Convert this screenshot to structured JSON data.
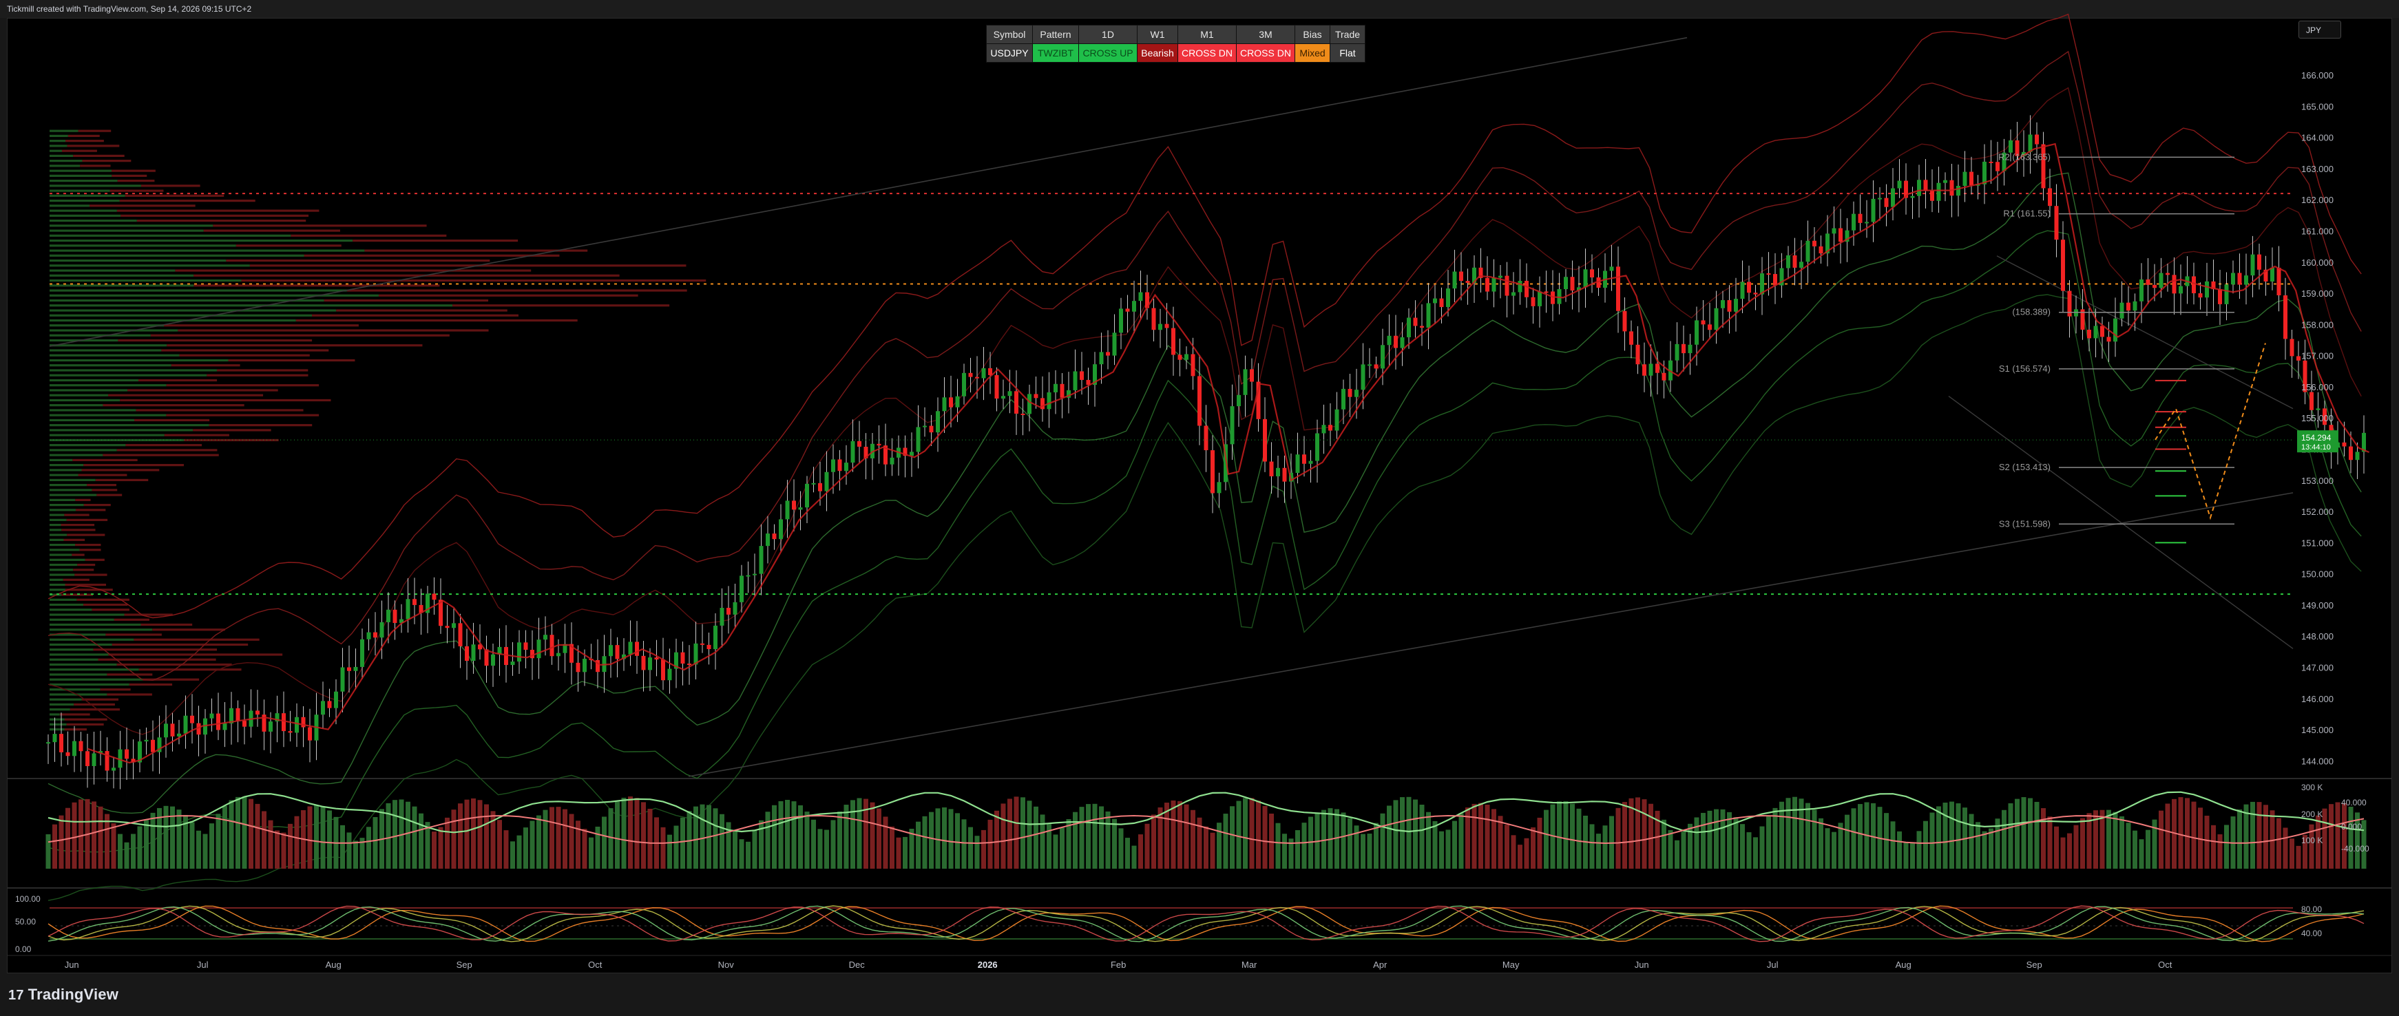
{
  "header": {
    "attribution": "Tickmill created with TradingView.com, Sep 14, 2026 09:15 UTC+2"
  },
  "currency_badge": "JPY",
  "signal_table": {
    "headers": [
      "Symbol",
      "Pattern",
      "1D",
      "W1",
      "M1",
      "3M",
      "Bias",
      "Trade"
    ],
    "values": [
      "USDJPY",
      "TWZIBT",
      "CROSS UP",
      "Bearish",
      "CROSS DN",
      "CROSS DN",
      "Mixed",
      "Flat"
    ],
    "colors": [
      "#3a3a3a",
      "#1fbf4a",
      "#1fbf4a",
      "#a31515",
      "#f0323c",
      "#f0323c",
      "#f08c1a",
      "#3a3a3a"
    ],
    "text_colors": [
      "#ffffff",
      "#0a4d1a",
      "#0a4d1a",
      "#ffffff",
      "#ffffff",
      "#ffffff",
      "#3a2000",
      "#ffffff"
    ]
  },
  "footer": {
    "brand": "TradingView"
  },
  "chart_data": [
    {
      "type": "candlestick",
      "symbol": "USDJPY",
      "ylim": [
        143.5,
        166.2
      ],
      "y_ticks": [
        "166.000",
        "165.000",
        "164.000",
        "163.000",
        "162.000",
        "161.000",
        "160.000",
        "159.000",
        "158.000",
        "157.000",
        "156.000",
        "155.000",
        "154.000",
        "153.000",
        "152.000",
        "151.000",
        "150.000",
        "149.000",
        "148.000",
        "147.000",
        "146.000",
        "145.000",
        "144.000"
      ],
      "x_ticks": [
        "Jun",
        "Jul",
        "Aug",
        "Sep",
        "Oct",
        "Nov",
        "Dec",
        "2026",
        "Feb",
        "Mar",
        "Apr",
        "May",
        "Jun",
        "Jul",
        "Aug",
        "Sep",
        "Oct"
      ],
      "close_path": [
        {
          "m": 0,
          "v": 144.6
        },
        {
          "m": 0.5,
          "v": 143.9
        },
        {
          "m": 1,
          "v": 145.1
        },
        {
          "m": 1.5,
          "v": 145.4
        },
        {
          "m": 2,
          "v": 145.0
        },
        {
          "m": 2.5,
          "v": 148.3
        },
        {
          "m": 2.9,
          "v": 149.2
        },
        {
          "m": 3.2,
          "v": 147.5
        },
        {
          "m": 3.5,
          "v": 147.3
        },
        {
          "m": 3.8,
          "v": 147.8
        },
        {
          "m": 4.1,
          "v": 147.0
        },
        {
          "m": 4.4,
          "v": 147.6
        },
        {
          "m": 4.7,
          "v": 146.9
        },
        {
          "m": 5.0,
          "v": 147.6
        },
        {
          "m": 5.3,
          "v": 149.6
        },
        {
          "m": 5.6,
          "v": 151.8
        },
        {
          "m": 5.9,
          "v": 153.0
        },
        {
          "m": 6.2,
          "v": 154.1
        },
        {
          "m": 6.5,
          "v": 153.7
        },
        {
          "m": 6.9,
          "v": 155.6
        },
        {
          "m": 7.1,
          "v": 156.6
        },
        {
          "m": 7.4,
          "v": 155.3
        },
        {
          "m": 7.7,
          "v": 155.8
        },
        {
          "m": 8.0,
          "v": 156.5
        },
        {
          "m": 8.3,
          "v": 159.0
        },
        {
          "m": 8.5,
          "v": 157.9
        },
        {
          "m": 8.75,
          "v": 156.4
        },
        {
          "m": 8.9,
          "v": 152.4
        },
        {
          "m": 9.15,
          "v": 156.8
        },
        {
          "m": 9.35,
          "v": 153.0
        },
        {
          "m": 9.6,
          "v": 153.6
        },
        {
          "m": 9.9,
          "v": 155.6
        },
        {
          "m": 10.2,
          "v": 157.2
        },
        {
          "m": 10.5,
          "v": 158.2
        },
        {
          "m": 10.8,
          "v": 159.6
        },
        {
          "m": 11.1,
          "v": 159.3
        },
        {
          "m": 11.4,
          "v": 158.8
        },
        {
          "m": 11.7,
          "v": 159.4
        },
        {
          "m": 11.95,
          "v": 159.6
        },
        {
          "m": 12.1,
          "v": 157.0
        },
        {
          "m": 12.3,
          "v": 156.3
        },
        {
          "m": 12.6,
          "v": 157.8
        },
        {
          "m": 12.9,
          "v": 158.9
        },
        {
          "m": 13.2,
          "v": 159.6
        },
        {
          "m": 13.5,
          "v": 160.5
        },
        {
          "m": 13.8,
          "v": 161.2
        },
        {
          "m": 14.1,
          "v": 162.3
        },
        {
          "m": 14.4,
          "v": 162.3
        },
        {
          "m": 14.7,
          "v": 162.6
        },
        {
          "m": 15.0,
          "v": 163.6
        },
        {
          "m": 15.2,
          "v": 163.8
        },
        {
          "m": 15.45,
          "v": 158.3
        },
        {
          "m": 15.7,
          "v": 157.5
        },
        {
          "m": 15.9,
          "v": 158.7
        },
        {
          "m": 16.1,
          "v": 159.5
        },
        {
          "m": 16.35,
          "v": 159.2
        },
        {
          "m": 16.6,
          "v": 159.0
        },
        {
          "m": 16.85,
          "v": 159.9
        },
        {
          "m": 17.0,
          "v": 159.6
        },
        {
          "m": 17.15,
          "v": 157.0
        },
        {
          "m": 17.35,
          "v": 155.0
        },
        {
          "m": 17.55,
          "v": 153.8
        },
        {
          "m": 17.75,
          "v": 154.3
        }
      ],
      "last_price": "154.294",
      "countdown": "13:44:10",
      "pivots": [
        {
          "label": "R2 (163.365)",
          "value": 163.365
        },
        {
          "label": "R1 (161.55)",
          "value": 161.55
        },
        {
          "label": "(158.389)",
          "value": 158.389
        },
        {
          "label": "S1 (156.574)",
          "value": 156.574
        },
        {
          "label": "S2 (153.413)",
          "value": 153.413
        },
        {
          "label": "S3 (151.598)",
          "value": 151.598
        }
      ],
      "horizontal_levels": [
        {
          "value": 162.2,
          "color": "#e03030"
        },
        {
          "value": 159.3,
          "color": "#f08c1a"
        },
        {
          "value": 149.35,
          "color": "#2ecc40"
        }
      ]
    },
    {
      "type": "bar",
      "name": "volume",
      "right_ticks": [
        "300 K",
        "200 K",
        "100 K"
      ],
      "oscillator_ticks": [
        "40.000",
        "0.000",
        "-40.000"
      ]
    },
    {
      "type": "line",
      "name": "stochastic",
      "left_ticks": [
        "100.00",
        "50.00",
        "0.00"
      ],
      "right_ticks": [
        "80.00",
        "40.00"
      ]
    }
  ]
}
